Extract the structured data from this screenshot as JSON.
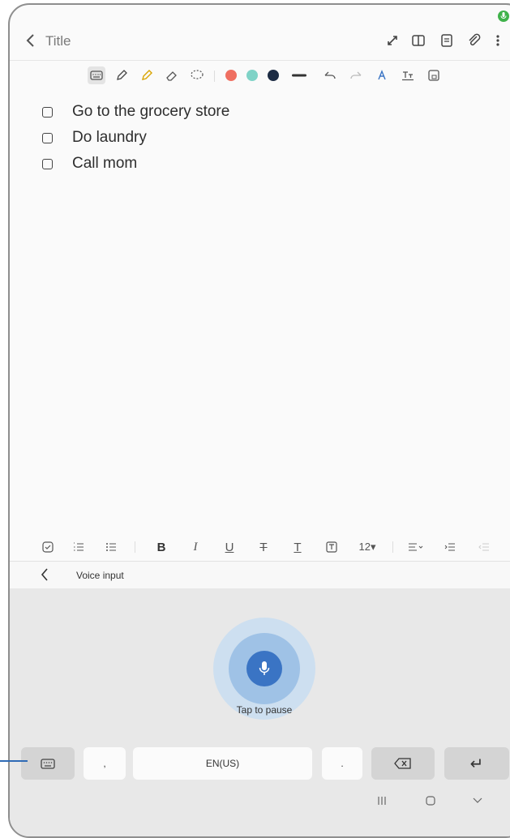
{
  "header": {
    "title": "Title",
    "icons": [
      "back-icon",
      "expand-icon",
      "book-view-icon",
      "page-icon",
      "attach-icon",
      "more-icon"
    ]
  },
  "tools": {
    "icons": [
      "keyboard-icon",
      "pen-icon",
      "highlighter-icon",
      "eraser-icon",
      "lasso-icon",
      "line-width-icon",
      "undo-icon",
      "redo-icon",
      "style-icon",
      "text-box-icon",
      "lock-icon"
    ],
    "colors": [
      "#ef6f61",
      "#7fd3c7",
      "#1d2c44"
    ]
  },
  "checklist": [
    {
      "text": "Go to the grocery store"
    },
    {
      "text": "Do laundry"
    },
    {
      "text": "Call mom"
    }
  ],
  "format": {
    "bold": "B",
    "italic": "I",
    "underline": "U",
    "strike": "T",
    "text_color": "T",
    "font_size": "12▾"
  },
  "voice": {
    "label": "Voice input",
    "status": "Tap to pause"
  },
  "keyboard": {
    "comma": ",",
    "space": "EN(US)",
    "period": ".",
    "enter": "↵"
  },
  "colors": {
    "accent": "#3a74c4",
    "mic_indicator": "#3fb24a"
  }
}
